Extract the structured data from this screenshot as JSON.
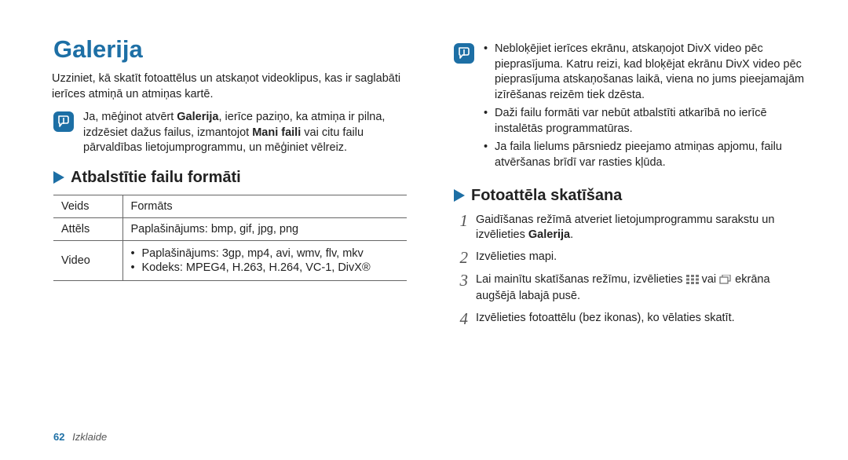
{
  "title": "Galerija",
  "intro": "Uzziniet, kā skatīt fotoattēlus un atskaņot videoklipus, kas ir saglabāti ierīces atmiņā un atmiņas kartē.",
  "note_left": {
    "prefix": "Ja, mēģinot atvērt ",
    "bold1": "Galerija",
    "mid": ", ierīce paziņo, ka atmiņa ir pilna, izdzēsiet dažus failus, izmantojot ",
    "bold2": "Mani faili",
    "suffix": " vai citu failu pārvaldības lietojumprogrammu, un mēģiniet vēlreiz."
  },
  "section_formats_heading": "Atbalstītie failu formāti",
  "table": {
    "head": {
      "c1": "Veids",
      "c2": "Formāts"
    },
    "rows": {
      "image": {
        "label": "Attēls",
        "value": "Paplašinājums: bmp, gif, jpg, png"
      },
      "video": {
        "label": "Video",
        "items": [
          "Paplašinājums: 3gp, mp4, avi, wmv, flv, mkv",
          "Kodeks: MPEG4, H.263, H.264, VC-1, DivX®"
        ]
      }
    }
  },
  "note_right": {
    "items": [
      "Nebloķējiet ierīces ekrānu, atskaņojot DivX video pēc pieprasījuma. Katru reizi, kad bloķējat ekrānu DivX video pēc pieprasījuma atskaņošanas laikā, viena no jums pieejamajām izīrēšanas reizēm tiek dzēsta.",
      "Daži failu formāti var nebūt atbalstīti atkarībā no ierīcē instalētās programmatūras.",
      "Ja faila lielums pārsniedz pieejamo atmiņas apjomu, failu atvēršanas brīdī var rasties kļūda."
    ]
  },
  "section_view_heading": "Fotoattēla skatīšana",
  "steps": {
    "s1": {
      "prefix": "Gaidīšanas režīmā atveriet lietojumprogrammu sarakstu un izvēlieties ",
      "bold": "Galerija",
      "suffix": "."
    },
    "s2": "Izvēlieties mapi.",
    "s3": {
      "prefix": "Lai mainītu skatīšanas režīmu, izvēlieties ",
      "mid": " vai ",
      "suffix": " ekrāna augšējā labajā pusē."
    },
    "s4": "Izvēlieties fotoattēlu (bez ikonas), ko vēlaties skatīt."
  },
  "footer": {
    "page": "62",
    "section": "Izklaide"
  }
}
